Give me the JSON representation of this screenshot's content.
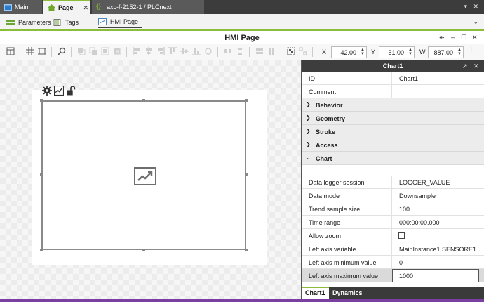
{
  "tabs": [
    {
      "label": "Main",
      "icon": "window-icon"
    },
    {
      "label": "Page",
      "icon": "home-icon",
      "active": true
    },
    {
      "label": "axc-f-2152-1 / PLCnext",
      "icon": "braces-icon"
    }
  ],
  "subtabs": [
    {
      "label": "Parameters",
      "icon": "parameters-icon"
    },
    {
      "label": "Tags",
      "icon": "tags-icon"
    },
    {
      "label": "HMI Page",
      "icon": "hmi-page-icon",
      "selected": true
    }
  ],
  "editor": {
    "title": "HMI Page"
  },
  "toolbar": {
    "x_label": "X",
    "x_value": "42.00",
    "y_label": "Y",
    "y_value": "51.00",
    "w_label": "W",
    "w_value": "887.00"
  },
  "panel": {
    "title": "Chart1",
    "top_rows": [
      {
        "key": "ID",
        "value": "Chart1"
      },
      {
        "key": "Comment",
        "value": ""
      }
    ],
    "sections": [
      "Behavior",
      "Geometry",
      "Stroke",
      "Access",
      "Chart"
    ],
    "chart_rows": [
      {
        "key": "Data logger session",
        "value": "LOGGER_VALUE"
      },
      {
        "key": "Data mode",
        "value": "Downsample"
      },
      {
        "key": "Trend sample size",
        "value": "100"
      },
      {
        "key": "Time range",
        "value": "000:00:00.000"
      },
      {
        "key": "Allow zoom",
        "value": ""
      },
      {
        "key": "Left axis variable",
        "value": "MainInstance1.SENSORE1"
      },
      {
        "key": "Left axis minimum value",
        "value": "0"
      },
      {
        "key": "Left axis maximum value",
        "value": "1000"
      }
    ],
    "footer_tabs": [
      "Chart1",
      "Dynamics"
    ]
  },
  "colors": {
    "accent": "#8bbd3a",
    "header_dark": "#3d3d3d"
  }
}
